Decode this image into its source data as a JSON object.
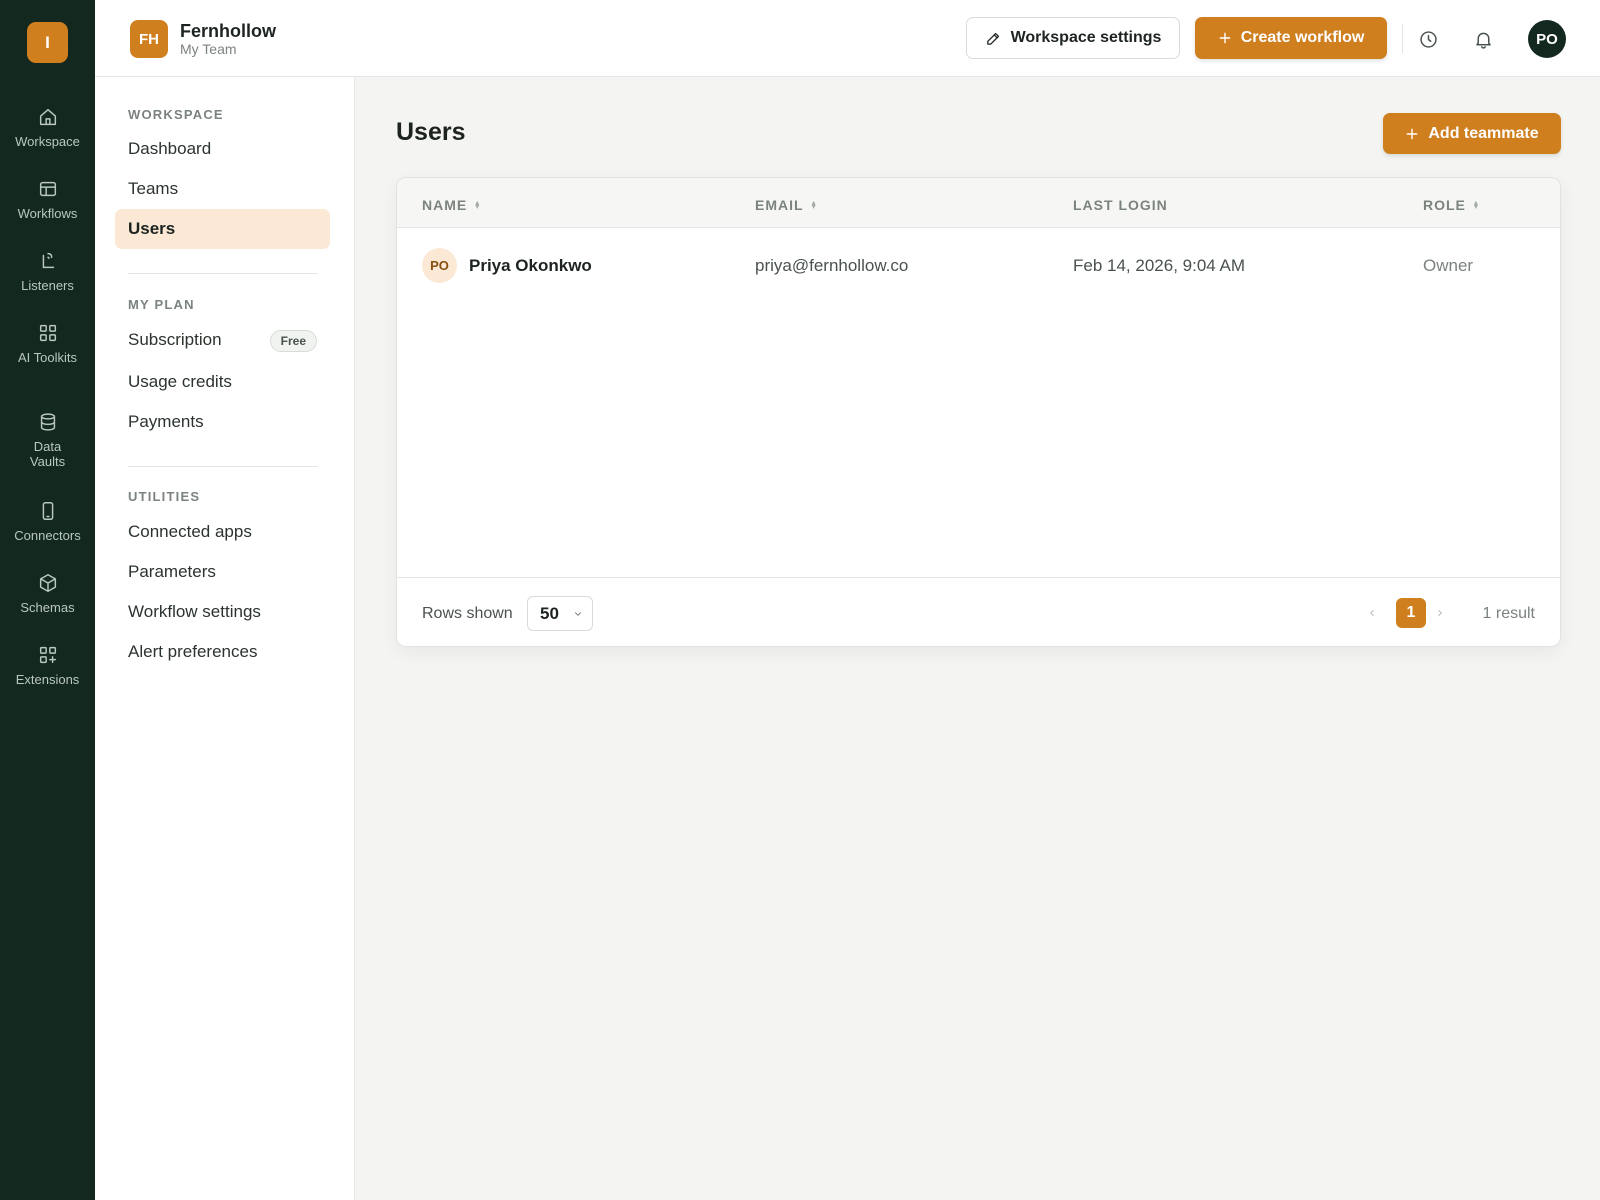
{
  "colors": {
    "accent": "#d07f1f",
    "rail_bg": "#13291f",
    "active_bg": "#fbe9d6"
  },
  "rail": {
    "logo": "I",
    "items": [
      {
        "label": "Workspace",
        "icon": "home-icon"
      },
      {
        "label": "Workflows",
        "icon": "layout-icon"
      },
      {
        "label": "Listeners",
        "icon": "listener-icon"
      },
      {
        "label": "AI Toolkits",
        "icon": "grid-icon"
      },
      {
        "label": "Data Vaults",
        "icon": "database-icon"
      },
      {
        "label": "Connectors",
        "icon": "phone-icon"
      },
      {
        "label": "Schemas",
        "icon": "cube-icon"
      },
      {
        "label": "Extensions",
        "icon": "grid-plus-icon"
      }
    ]
  },
  "header": {
    "badge": "FH",
    "workspace_name": "Fernhollow",
    "team_name": "My Team",
    "settings_button": "Workspace settings",
    "create_button": "Create workflow",
    "user_initials": "PO"
  },
  "sidenav": {
    "workspace_title": "WORKSPACE",
    "workspace_items": [
      "Dashboard",
      "Teams",
      "Users"
    ],
    "active_item": "Users",
    "plan_title": "MY PLAN",
    "plan_items": [
      "Subscription",
      "Usage credits",
      "Payments"
    ],
    "plan_badge": "Free",
    "utilities_title": "UTILITIES",
    "utilities_items": [
      "Connected apps",
      "Parameters",
      "Workflow settings",
      "Alert preferences"
    ]
  },
  "main": {
    "title": "Users",
    "add_button": "Add teammate",
    "table": {
      "columns": [
        "NAME",
        "EMAIL",
        "LAST LOGIN",
        "ROLE"
      ],
      "rows": [
        {
          "initials": "PO",
          "name": "Priya Okonkwo",
          "email": "priya@fernhollow.co",
          "last_login": "Feb 14, 2026, 9:04 AM",
          "role": "Owner"
        }
      ]
    },
    "footer": {
      "rows_label": "Rows shown",
      "rows_value": "50",
      "current_page": "1",
      "result_text": "1 result"
    }
  }
}
